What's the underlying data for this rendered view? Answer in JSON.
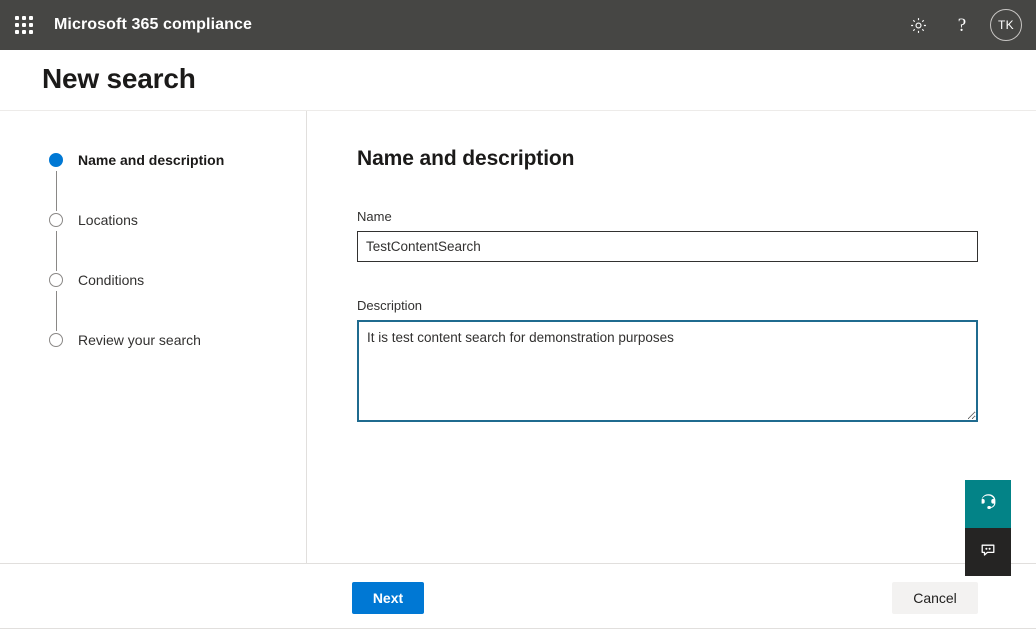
{
  "topbar": {
    "waffle_icon": "app-launcher-waffle-icon",
    "brand": "Microsoft 365 compliance",
    "settings_icon": "gear-icon",
    "help_icon": "question-mark-icon",
    "help_glyph": "?",
    "avatar_initials": "TK",
    "bar_color": "#464644"
  },
  "page": {
    "title": "New search"
  },
  "wizard": {
    "steps": [
      {
        "label": "Name and description",
        "state": "active"
      },
      {
        "label": "Locations",
        "state": "pending"
      },
      {
        "label": "Conditions",
        "state": "pending"
      },
      {
        "label": "Review your search",
        "state": "pending"
      }
    ],
    "active_color": "#0078d4",
    "pending_color": "#8a8886"
  },
  "main": {
    "section_title": "Name and description",
    "name_field": {
      "label": "Name",
      "value": "TestContentSearch",
      "placeholder": ""
    },
    "description_field": {
      "label": "Description",
      "value": "It is test content search for demonstration purposes",
      "placeholder": "",
      "focus_border_color": "#1f6b8f"
    }
  },
  "float_buttons": {
    "support": {
      "icon": "headset-icon",
      "color": "#038387"
    },
    "feedback": {
      "icon": "feedback-chat-bubble-icon",
      "color": "#252423"
    }
  },
  "footer": {
    "next_label": "Next",
    "cancel_label": "Cancel",
    "primary_color": "#0078d4"
  }
}
